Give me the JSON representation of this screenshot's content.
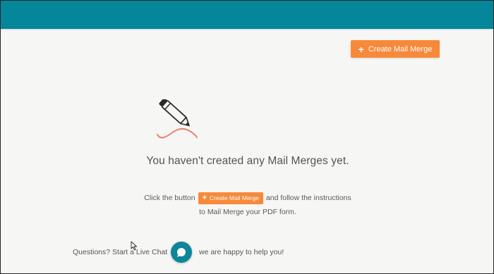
{
  "header": {
    "color": "#04869b"
  },
  "toolbar": {
    "create_icon": "plus-icon",
    "create_label": "Create Mail Merge",
    "accent_color": "#f7893a"
  },
  "empty_state": {
    "illustration": "pen-icon",
    "title": "You haven't created any Mail Merges yet.",
    "instruction_prefix": "Click the button",
    "inline_button_label": "Create Mail Merge",
    "instruction_suffix": "and follow the instructions",
    "instruction_line2": "to Mail Merge your PDF form."
  },
  "help": {
    "text_before": "Questions? Start a Live Chat",
    "chat_icon": "chat-bubble-icon",
    "text_after": "we are happy to help you!"
  }
}
